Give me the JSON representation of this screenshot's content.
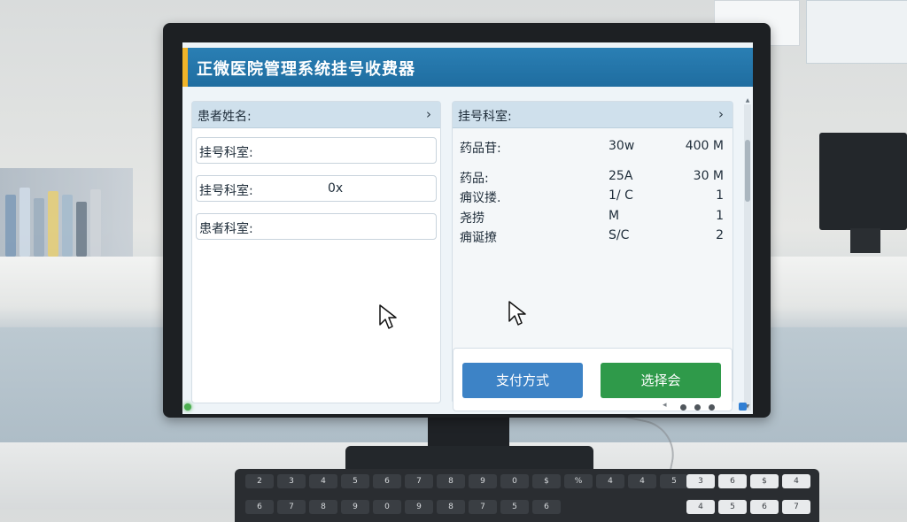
{
  "app": {
    "title": "正微医院管理系统挂号收费器"
  },
  "left_panel": {
    "header": "患者姓名:",
    "fields": [
      {
        "label": "挂号科室:",
        "value": ""
      },
      {
        "label": "挂号科室:",
        "value": "0x"
      },
      {
        "label": "患者科室:",
        "value": ""
      }
    ]
  },
  "right_panel": {
    "header": "挂号科室:",
    "items": [
      {
        "name": "药品苷:",
        "spec": "30w",
        "amount": "400 M"
      },
      {
        "name": "药品:",
        "spec": "25A",
        "amount": "30 M"
      },
      {
        "name": "痈议搂.",
        "spec": "1/ C",
        "amount": "1"
      },
      {
        "name": "尧捞",
        "spec": "M",
        "amount": "1"
      },
      {
        "name": "痈诞撩",
        "spec": "S/C",
        "amount": "2"
      }
    ],
    "buttons": {
      "pay": "支付方式",
      "select": "选择会"
    }
  },
  "keyboard": {
    "keys": [
      "2",
      "3",
      "4",
      "5",
      "6",
      "7",
      "8",
      "9",
      "0",
      "$",
      "%",
      "4",
      "4",
      "5",
      "6",
      "7",
      "8",
      "9",
      "0",
      "9",
      "8",
      "7",
      "5",
      "6"
    ],
    "numpad": [
      "3",
      "6",
      "$",
      "4",
      "4",
      "5",
      "6",
      "7"
    ]
  },
  "colors": {
    "title_bar": "#1f6da0",
    "title_accent": "#f0b429",
    "pay_button": "#3d83c6",
    "select_button": "#2f9a4a"
  },
  "icons": {
    "chevron": "chevron-right-icon",
    "cursor": "mouse-cursor-icon"
  }
}
